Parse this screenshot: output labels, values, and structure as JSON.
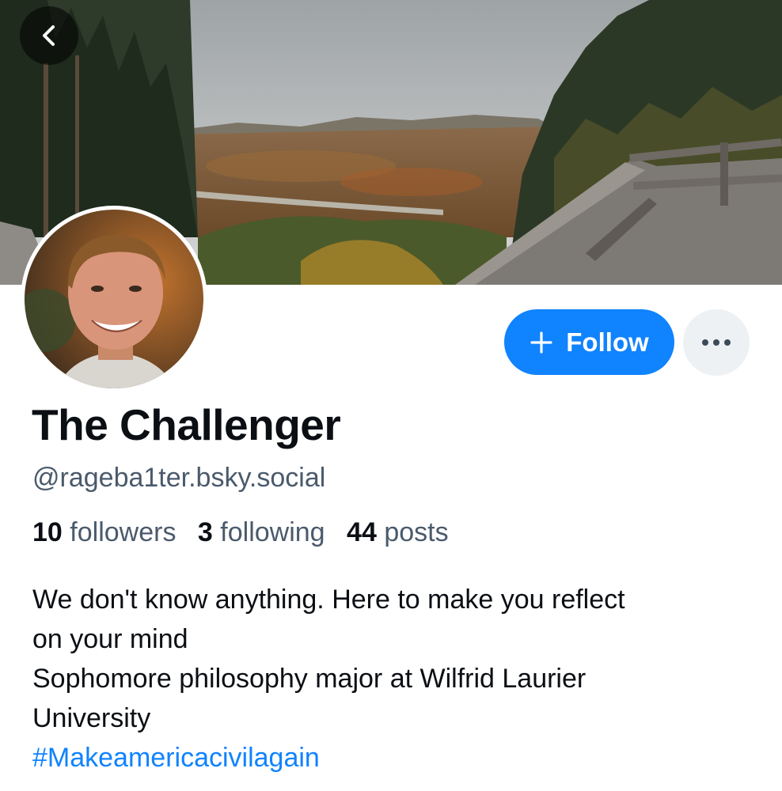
{
  "header": {
    "back_icon": "chevron-left-icon"
  },
  "profile": {
    "display_name": "The Challenger",
    "handle": "@rageba1ter.bsky.social",
    "follow_label": "Follow",
    "follow_icon": "plus-icon",
    "more_icon": "ellipsis-icon"
  },
  "stats": {
    "followers_count": "10",
    "followers_label": "followers",
    "following_count": "3",
    "following_label": "following",
    "posts_count": "44",
    "posts_label": "posts"
  },
  "bio": {
    "line1": "We don't know anything. Here to make you reflect",
    "line2": "on your mind",
    "line3": "Sophomore philosophy major at Wilfrid Laurier",
    "line4": "University",
    "hashtag": "#Makeamericacivilagain"
  },
  "colors": {
    "accent": "#1083fe",
    "secondary_text": "#4a5a6c",
    "primary_text": "#0b0f14",
    "more_button_bg": "#eef1f4"
  }
}
